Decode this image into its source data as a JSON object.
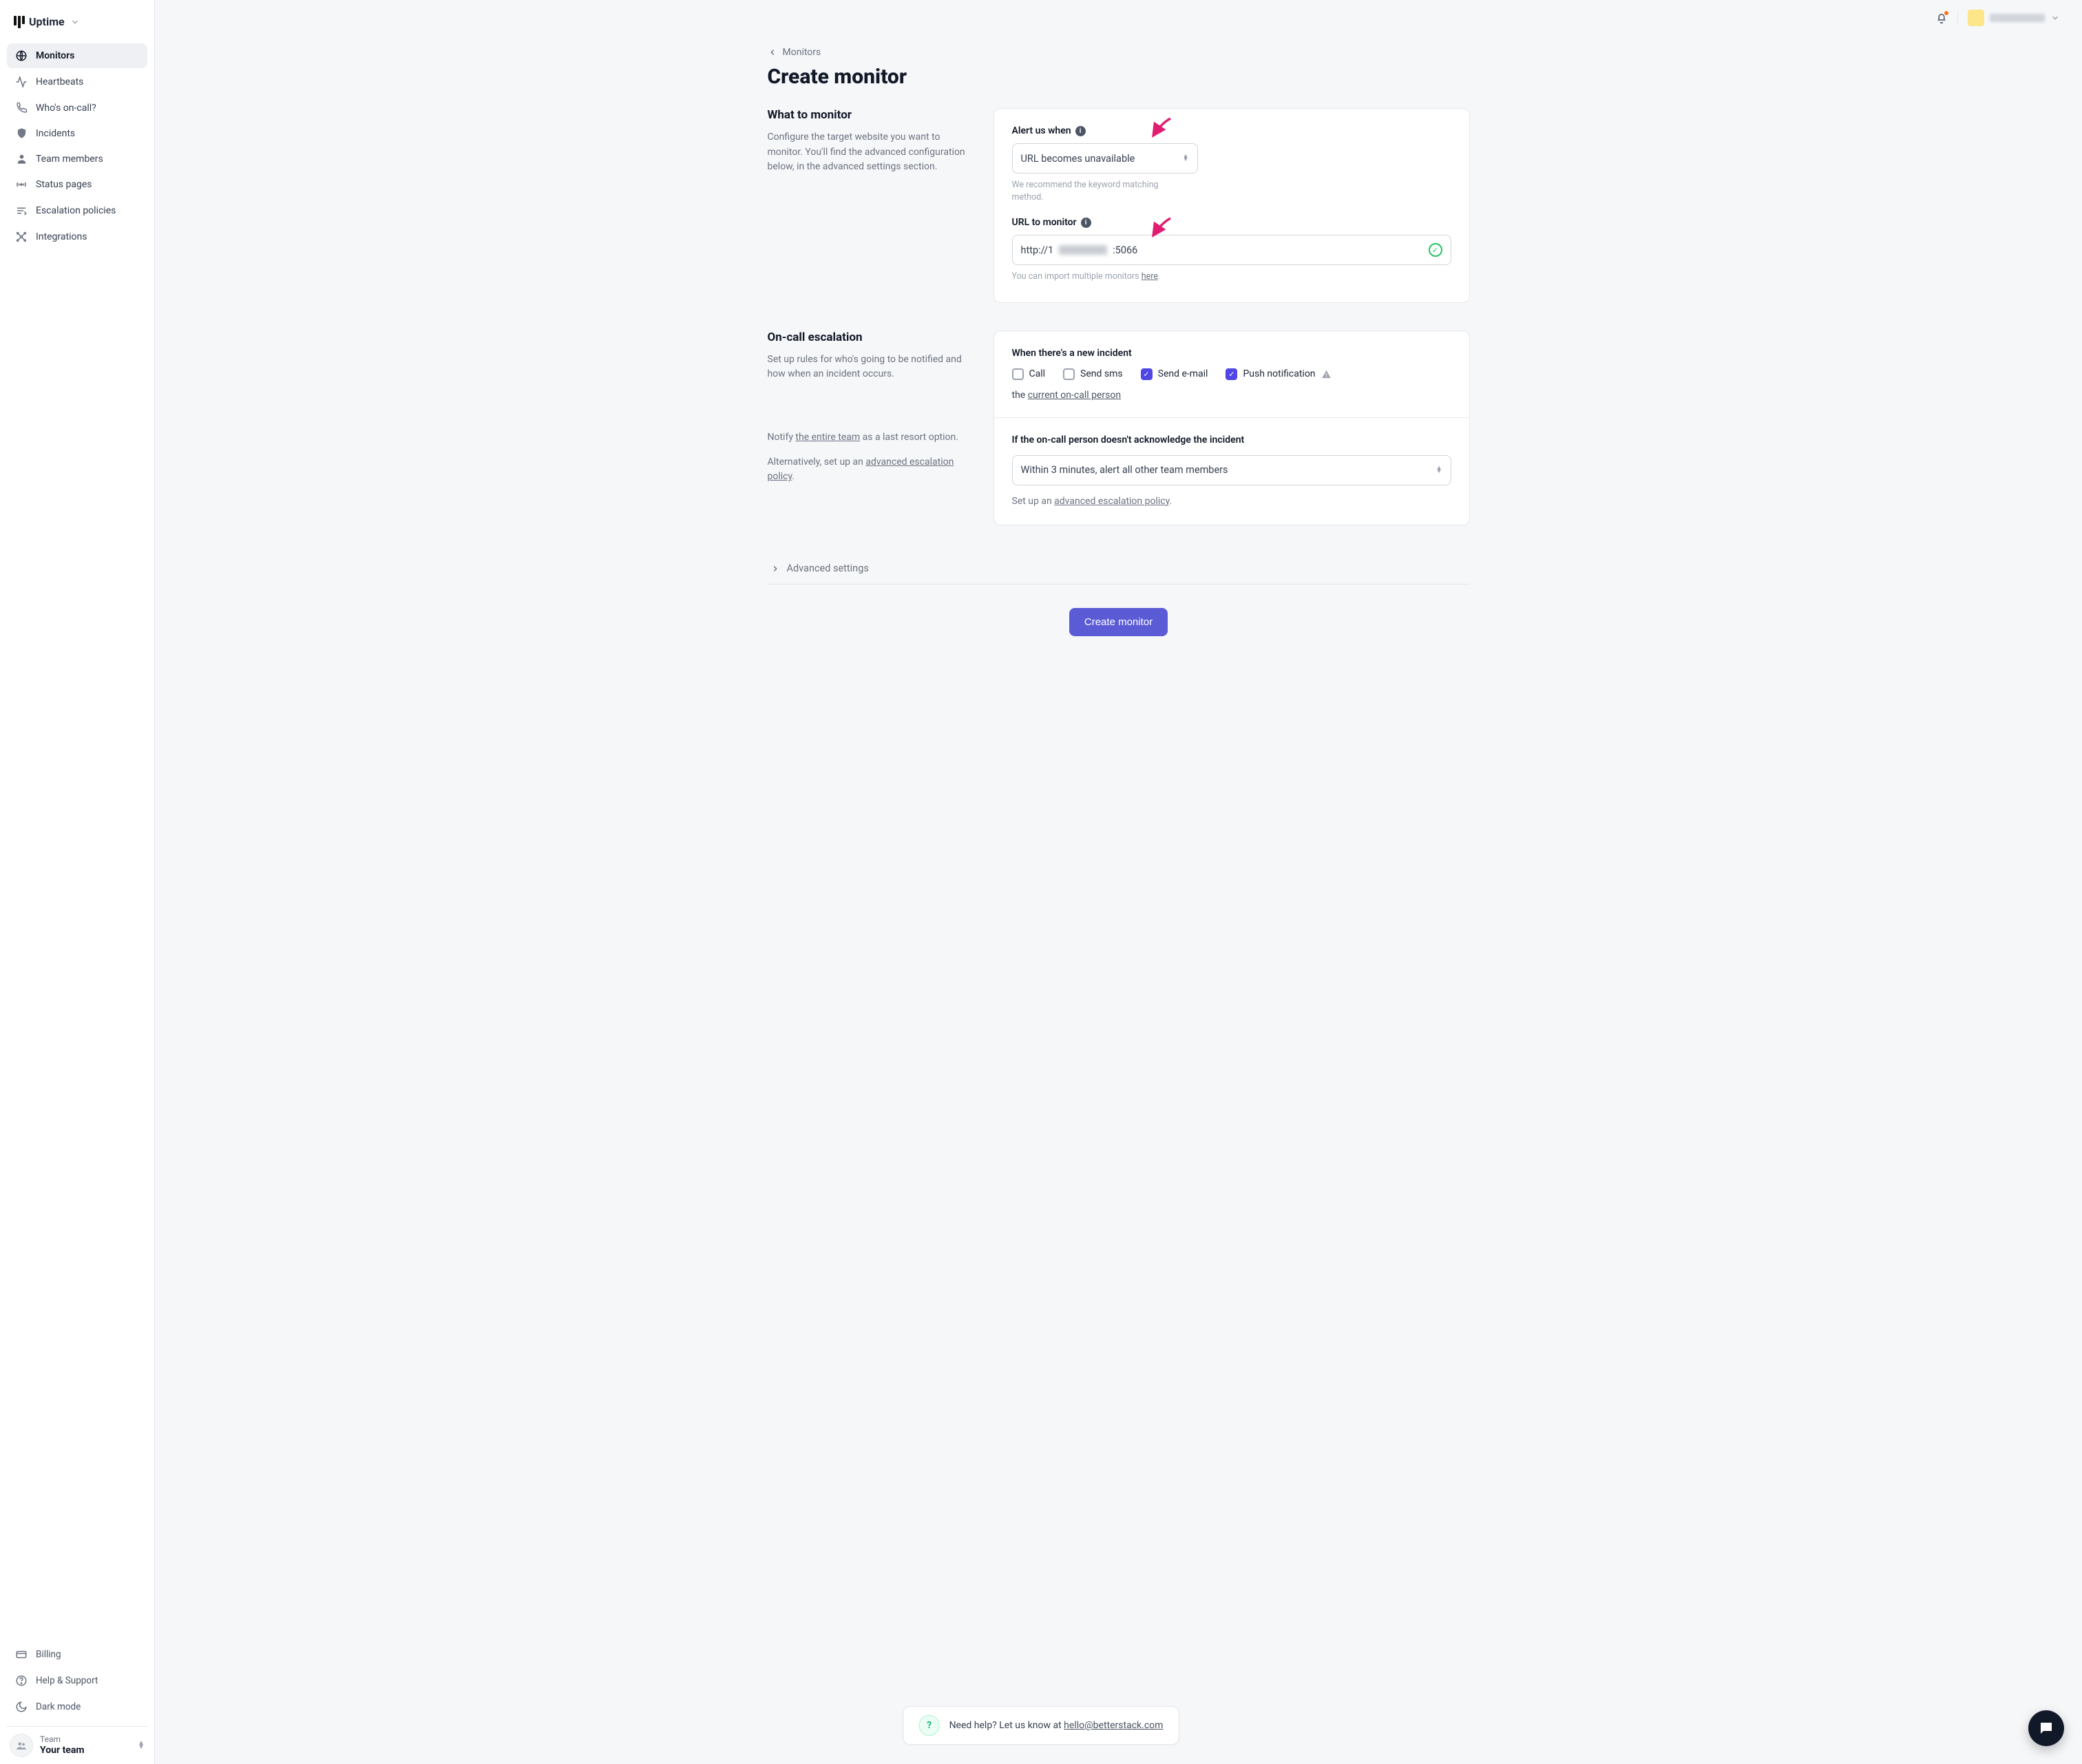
{
  "brand": {
    "name": "Uptime"
  },
  "sidebar": {
    "items": [
      {
        "label": "Monitors"
      },
      {
        "label": "Heartbeats"
      },
      {
        "label": "Who's on-call?"
      },
      {
        "label": "Incidents"
      },
      {
        "label": "Team members"
      },
      {
        "label": "Status pages"
      },
      {
        "label": "Escalation policies"
      },
      {
        "label": "Integrations"
      }
    ],
    "bottom": [
      {
        "label": "Billing"
      },
      {
        "label": "Help & Support"
      },
      {
        "label": "Dark mode"
      }
    ],
    "team": {
      "label": "Team",
      "value": "Your team"
    }
  },
  "breadcrumb": {
    "back": "Monitors"
  },
  "page": {
    "title": "Create monitor"
  },
  "section_monitor": {
    "heading": "What to monitor",
    "description": "Configure the target website you want to monitor. You'll find the advanced configuration below, in the advanced settings section."
  },
  "alert": {
    "label": "Alert us when",
    "value": "URL becomes unavailable",
    "hint": "We recommend the keyword matching method."
  },
  "url": {
    "label": "URL to monitor",
    "value_prefix": "http://1",
    "value_suffix": ":5066",
    "hint_prefix": "You can import multiple monitors ",
    "hint_link": "here",
    "hint_suffix": "."
  },
  "section_escalation": {
    "heading": "On-call escalation",
    "description": "Set up rules for who's going to be notified and how when an incident occurs.",
    "notify_prefix": "Notify ",
    "notify_link": "the entire team",
    "notify_suffix": " as a last resort option.",
    "alt_prefix": "Alternatively, set up an ",
    "alt_link": "advanced escalation policy",
    "alt_suffix": "."
  },
  "incident": {
    "heading": "When there's a new incident",
    "options": {
      "call": "Call",
      "sms": "Send sms",
      "email": "Send e-mail",
      "push": "Push notification"
    },
    "the_text": "the ",
    "current_link": "current on-call person"
  },
  "ack": {
    "heading": "If the on-call person doesn't acknowledge the incident",
    "select_value": "Within 3 minutes, alert all other team members",
    "hint_prefix": "Set up an ",
    "hint_link": "advanced escalation policy",
    "hint_suffix": "."
  },
  "advanced": {
    "label": "Advanced settings"
  },
  "submit": {
    "label": "Create monitor"
  },
  "help": {
    "text": "Need help? Let us know at ",
    "email": "hello@betterstack.com"
  }
}
